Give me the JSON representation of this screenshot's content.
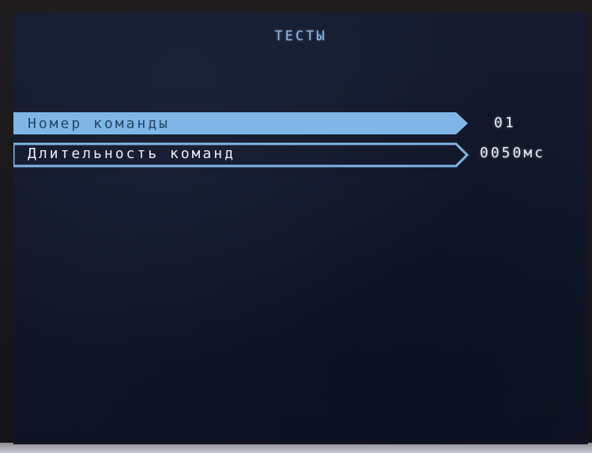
{
  "screen": {
    "title": "ТЕСТЫ"
  },
  "menu": {
    "items": [
      {
        "label": "Номер команды",
        "value": "01",
        "selected": true
      },
      {
        "label": "Длительность команд",
        "value": "0050мс",
        "selected": false
      }
    ]
  },
  "colors": {
    "screen_bg": "#121829",
    "accent_blue": "#7fb6e6",
    "title_text": "#8fb7e2",
    "value_text": "#e6ecf5"
  }
}
